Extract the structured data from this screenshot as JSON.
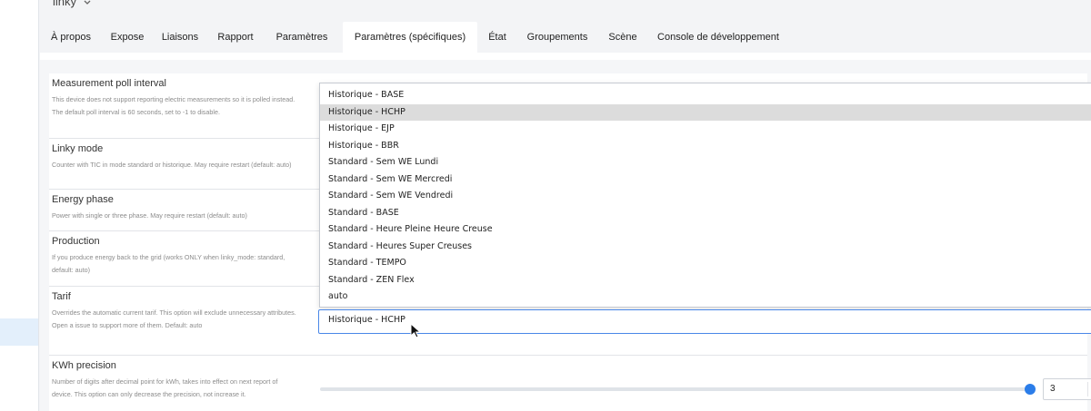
{
  "device": {
    "title": "linky",
    "chevron": "chevron-down-icon"
  },
  "tabs": [
    {
      "label": "À propos"
    },
    {
      "label": "Expose"
    },
    {
      "label": "Liaisons"
    },
    {
      "label": "Rapport"
    },
    {
      "label": "Paramètres"
    },
    {
      "label": "Paramètres (spécifiques)",
      "active": true
    },
    {
      "label": "État"
    },
    {
      "label": "Groupements"
    },
    {
      "label": "Scène"
    },
    {
      "label": "Console de développement"
    }
  ],
  "settings": [
    {
      "title": "Measurement poll interval",
      "description": "This device does not support reporting electric measurements so it is polled instead. The default poll interval is 60 seconds, set to -1 to disable."
    },
    {
      "title": "Linky mode",
      "description": "Counter with TIC in mode standard or historique. May require restart (default: auto)"
    },
    {
      "title": "Energy phase",
      "description": "Power with single or three phase. May require restart (default: auto)"
    },
    {
      "title": "Production",
      "description": "If you produce energy back to the grid (works ONLY when linky_mode: standard, default: auto)"
    },
    {
      "title": "Tarif",
      "description": "Overrides the automatic current tarif. This option will exclude unnecessary attributes. Open a issue to support more of them. Default: auto"
    },
    {
      "title": "KWh precision",
      "description": "Number of digits after decimal point for kWh, takes into effect on next report of device. This option can only decrease the precision, not increase it."
    }
  ],
  "tarif_dropdown": {
    "options": [
      "Historique - BASE",
      "Historique - HCHP",
      "Historique - EJP",
      "Historique - BBR",
      "Standard - Sem WE Lundi",
      "Standard - Sem WE Mercredi",
      "Standard - Sem WE Vendredi",
      "Standard - BASE",
      "Standard - Heure Pleine Heure Creuse",
      "Standard - Heures Super Creuses",
      "Standard - TEMPO",
      "Standard - ZEN Flex",
      "auto"
    ],
    "highlighted": "Historique - HCHP",
    "value": "Historique - HCHP"
  },
  "kwh_precision": {
    "value": "3",
    "slider_fraction": 0.999
  },
  "colors": {
    "accent": "#2b7de9",
    "focus_border": "#4a87e8",
    "highlight": "#dcdcdc",
    "rail_active": "#e3effb"
  },
  "icons": {
    "cursor": "mouse-pointer-icon"
  }
}
